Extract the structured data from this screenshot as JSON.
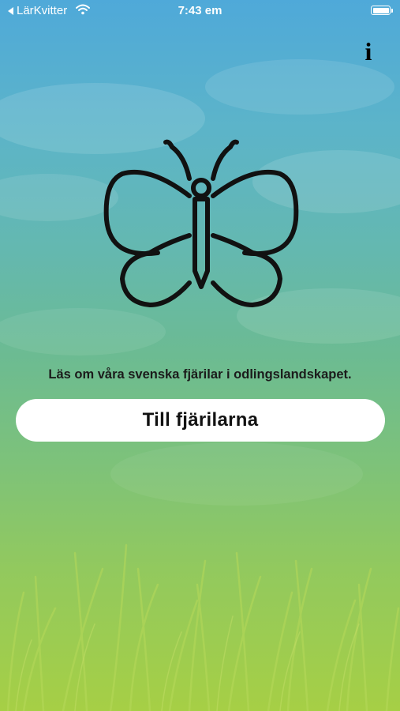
{
  "status_bar": {
    "back_label": "LärKvitter",
    "time": "7:43 em"
  },
  "icons": {
    "back": "back-arrow-icon",
    "wifi": "wifi-icon",
    "battery": "battery-icon",
    "info": "info-icon",
    "butterfly": "butterfly-icon"
  },
  "info_label": "i",
  "main": {
    "tagline": "Läs om våra svenska fjärilar i odlingslandskapet.",
    "button_label": "Till fjärilarna"
  },
  "colors": {
    "sky_top": "#4fa9d9",
    "grass_bottom": "#a6cf45",
    "button_bg": "#ffffff",
    "text": "#1b1b1b"
  }
}
